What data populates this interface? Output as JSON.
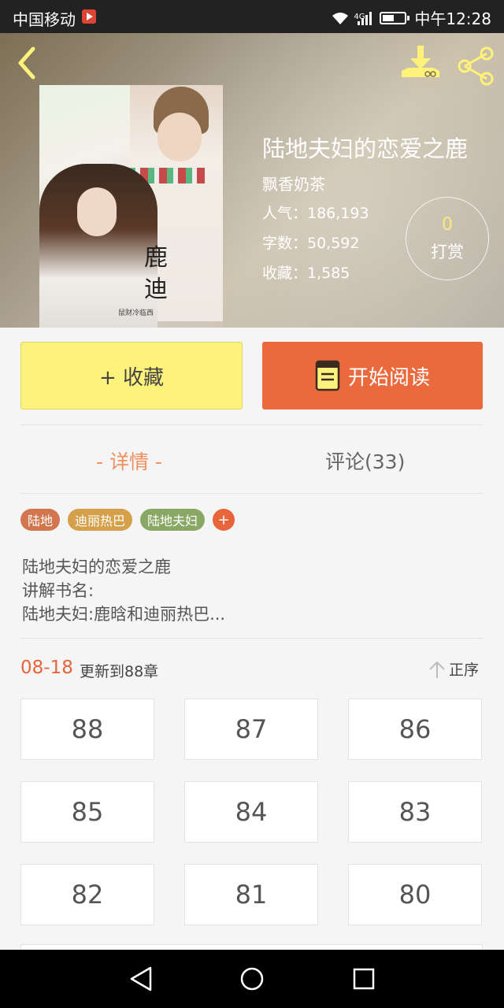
{
  "status_bar": {
    "carrier": "中国移动",
    "network": "4G",
    "time": "中午12:28"
  },
  "book": {
    "title": "陆地夫妇的恋爱之鹿",
    "author": "飘香奶茶",
    "popularity": "人气：186,193",
    "word_count": "字数：50,592",
    "favorites": "收藏：1,585",
    "tip_count": "0",
    "tip_label": "打赏",
    "cover_text": "鹿迪",
    "cover_sub": "鼠财冷临西"
  },
  "actions": {
    "favorite": "+ 收藏",
    "read": "开始阅读"
  },
  "tabs": {
    "detail": "- 详情 -",
    "comments": "评论(33)"
  },
  "tags": [
    "陆地",
    "迪丽热巴",
    "陆地夫妇"
  ],
  "tag_add": "+",
  "description": [
    "陆地夫妇的恋爱之鹿",
    "讲解书名:",
    "陆地夫妇:鹿晗和迪丽热巴..."
  ],
  "update": {
    "date": "08-18",
    "text": "更新到88章",
    "order": "正序"
  },
  "chapters": [
    "88",
    "87",
    "86",
    "85",
    "84",
    "83",
    "82",
    "81",
    "80"
  ],
  "colors": {
    "accent": "#e8643a",
    "favorite_bg": "#fdf27c",
    "read_bg": "#ea6a3e",
    "tab_active": "#f0905e"
  }
}
